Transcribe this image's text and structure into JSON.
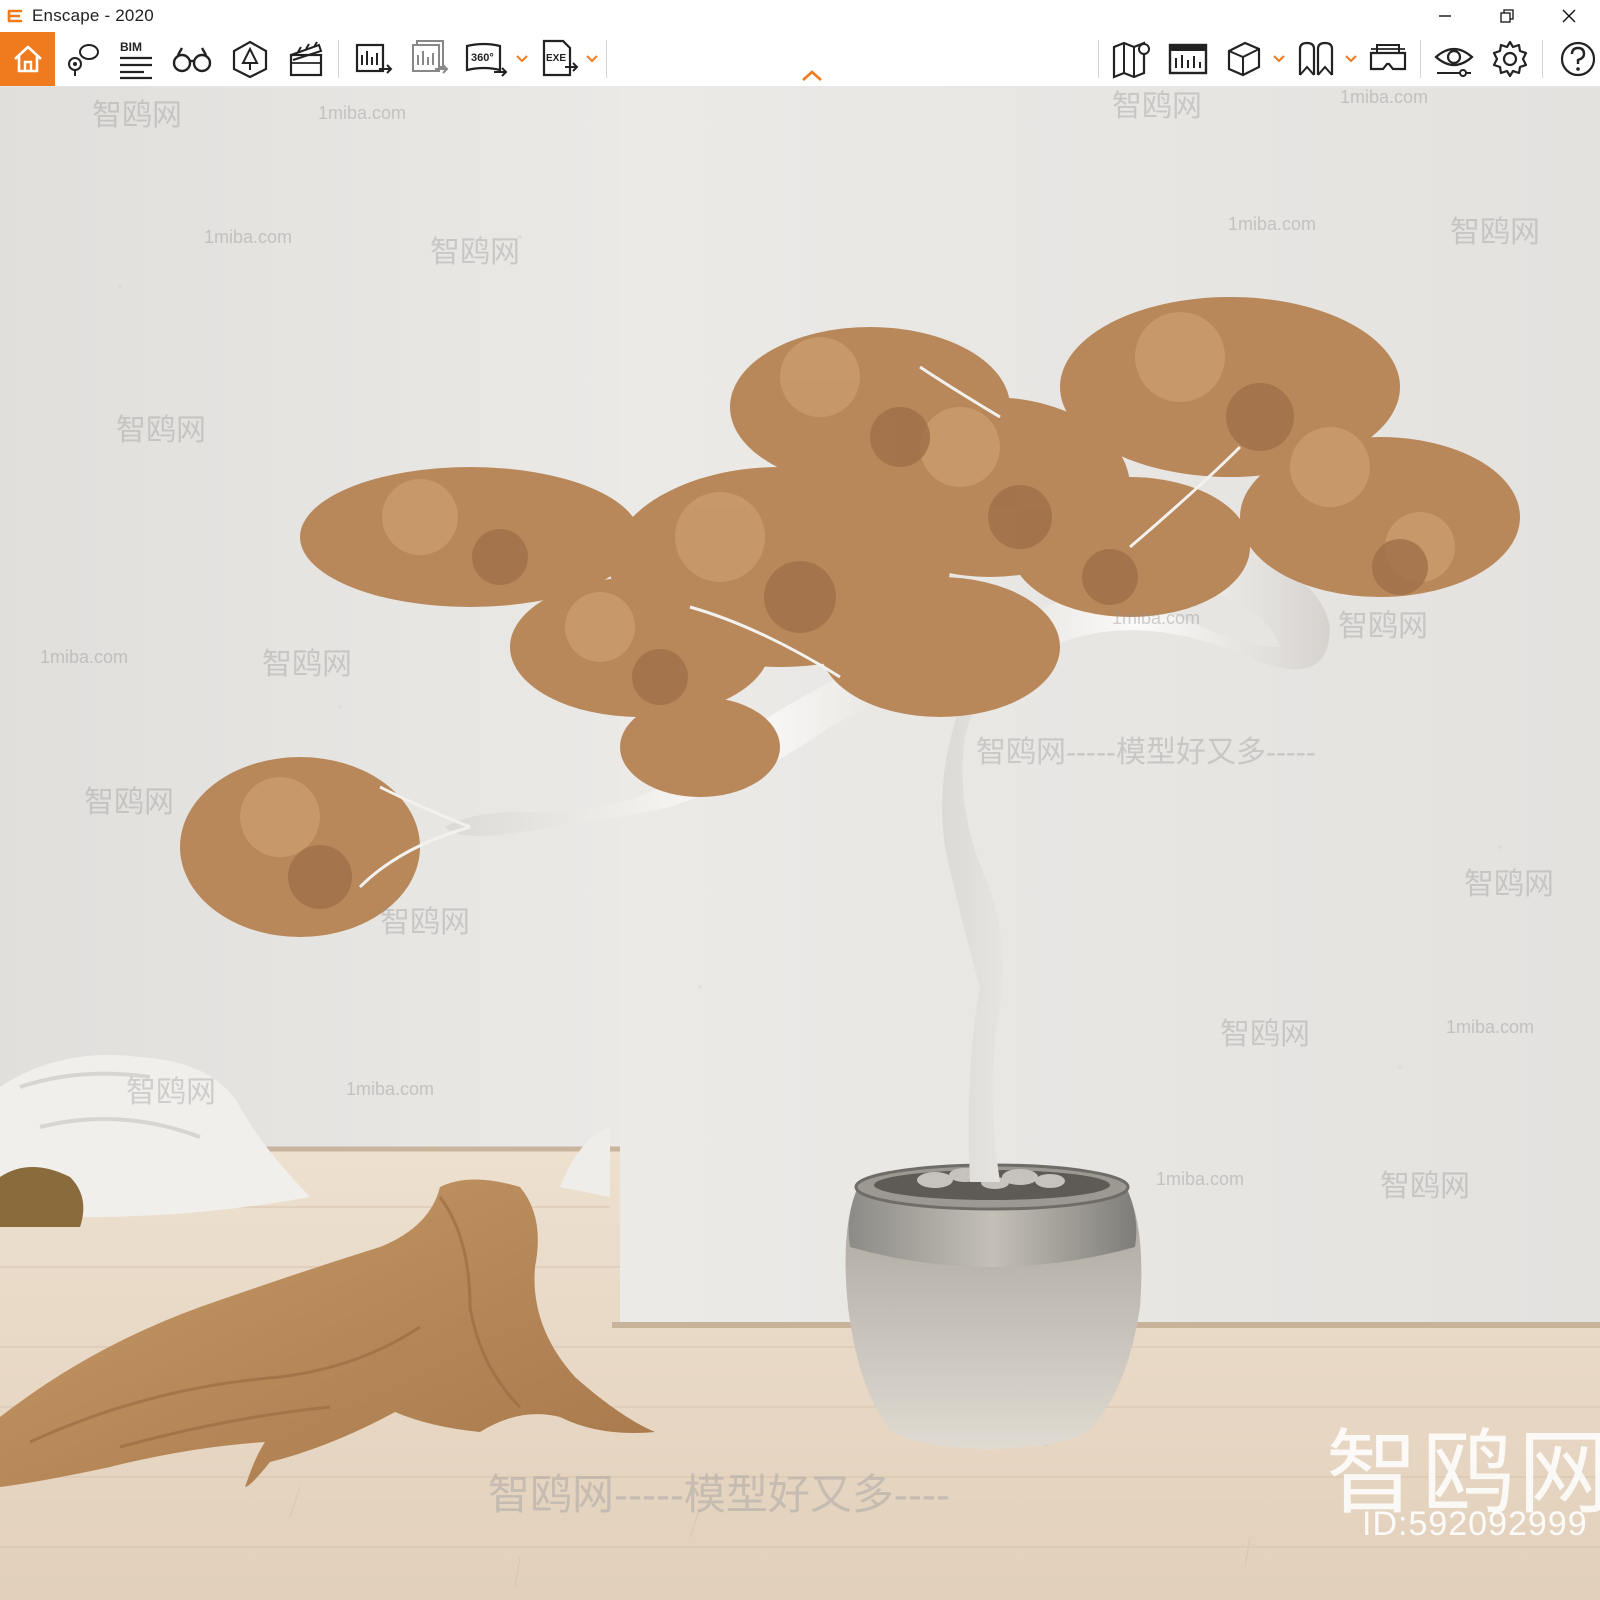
{
  "window": {
    "title": "Enscape - 2020",
    "controls": [
      "minimize",
      "restore",
      "close"
    ]
  },
  "colors": {
    "accent": "#f07a1e",
    "wall": "#e9e7e4",
    "floor": "#e6d6c3",
    "foliage": "#b98a5e",
    "trunk": "#f2f0ed"
  },
  "toolbar": {
    "bim_label": "BIM",
    "video_360_label": "360°",
    "exe_label": "EXE",
    "left_tools": [
      "home-icon",
      "view-management-icon",
      "bim-icon",
      "binoculars-icon",
      "asset-library-icon",
      "video-editor-icon",
      "batch-render-icon",
      "render-image-icon",
      "render-360-icon",
      "export-exe-icon"
    ],
    "right_tools": [
      "map-icon",
      "screenshot-panel-icon",
      "cube-icon",
      "bookmark-icon",
      "vr-headset-icon",
      "visual-settings-icon",
      "settings-icon",
      "help-icon"
    ]
  },
  "watermarks": {
    "brand": "智鸥网",
    "site": "1miba.com",
    "slogan": "智鸥网-----模型好又多----",
    "mid_slogan": "智鸥网-----模型好又多-----",
    "id_label": "ID:592092999"
  }
}
